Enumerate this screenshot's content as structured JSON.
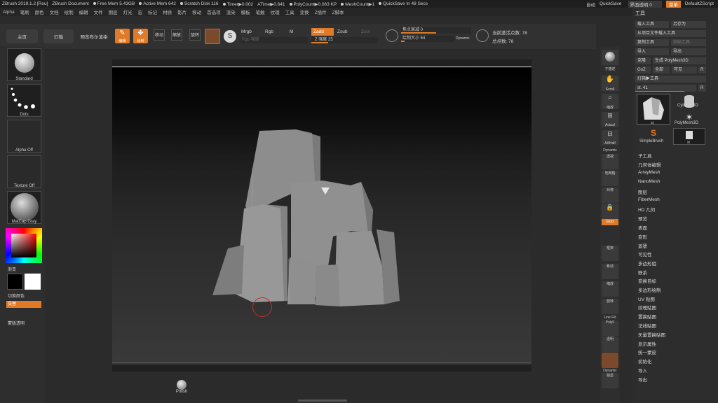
{
  "titlebar": {
    "items": [
      "ZBrush 2019.1.2 [Rou]",
      "ZBrush Document",
      "Free Mem 5.43GB",
      "Active Mem 642",
      "Scratch Disk 116",
      "Timer▶0.002",
      "ATime▶0.641",
      "PolyCount▶0.063 KP",
      "MeshCount▶1",
      "QuickSave In 48 Secs"
    ],
    "right": [
      "自动",
      "QuickSave",
      "界面透明 0",
      "菜单",
      "DefaultZScript"
    ]
  },
  "menubar": {
    "items": [
      "Alpha",
      "笔刷",
      "颜色",
      "文档",
      "绘制",
      "编辑",
      "文件",
      "图层",
      "灯光",
      "宏",
      "标记",
      "材质",
      "影片",
      "移动",
      "首选项",
      "渲染",
      "模板",
      "笔触",
      "纹理",
      "工具",
      "变换",
      "Z插件",
      "Z脚本"
    ]
  },
  "toolbar": {
    "home": "主页",
    "lightbox": "灯箱",
    "preview_render": "预览布尔渲染",
    "edit": "编辑",
    "draw": "绘制",
    "move": "移动",
    "scale": "缩放",
    "rotate": "旋转",
    "mrgb": "Mrgb",
    "rgb": "Rgb",
    "m": "M",
    "zadd": "Zadd",
    "zsub": "Zsub",
    "zcut": "Zcut",
    "rgb_intensity": "Rgb 强度",
    "z_intensity": "Z 强度 25",
    "focal_shift": "焦点衰减 0",
    "draw_size": "绘制大小 64",
    "dynamic": "Dynamic",
    "active_points": "当前激活点数: 78",
    "total_points": "总点数: 78"
  },
  "left": {
    "brush": "Standard",
    "stroke": "Dots",
    "alpha": "Alpha Off",
    "texture": "Texture Off",
    "material": "MatCap Gray",
    "gradient": "渐变",
    "switch_color": "切换颜色",
    "alternate": "交替",
    "mask": "蒙版透明"
  },
  "right_shelf": {
    "labels": [
      "子描述",
      "Scroll",
      "缩放",
      "Actual",
      "AAHalf",
      "Dynamic",
      "透视",
      "地网格",
      "对称",
      "Gxyz",
      "框架",
      "移动",
      "缩放",
      "旋转",
      "Line Fill",
      "PolyF",
      "透明",
      "Dynamic",
      "独显"
    ]
  },
  "palette": {
    "header": "工具",
    "buttons": [
      "载入工具",
      "另存为",
      "从项目文件载入工具",
      "复制工具",
      "粘贴工具",
      "导入",
      "导出",
      "克隆",
      "生成 PolyMesh3D",
      "GoZ",
      "全部",
      "可见",
      "R"
    ],
    "lightbox_tools": "灯箱▶工具",
    "current_tool": "st. 41",
    "r": "R",
    "thumbs": [
      "st",
      "Cylinder3D",
      "PolyMesh3D",
      "SimpleBrush",
      "st"
    ],
    "sections": [
      "子工具",
      "几何体编辑",
      "ArrayMesh",
      "NanoMesh",
      "图层",
      "FiberMesh",
      "HD 几何",
      "预览",
      "表面",
      "变形",
      "遮罩",
      "可见性",
      "多边形组",
      "联系",
      "变换目标",
      "多边形绘制",
      "UV 贴图",
      "纹理贴图",
      "置换贴图",
      "法线贴图",
      "矢量置换贴图",
      "显示属性",
      "统一蒙皮",
      "初始化",
      "导入",
      "导出"
    ]
  },
  "bottom": {
    "brush": "Polish"
  },
  "colors": {
    "accent": "#e07a26",
    "canvas_top": "#000000",
    "canvas_bottom": "#3a3a3a",
    "rock": "#8e8e8e"
  }
}
